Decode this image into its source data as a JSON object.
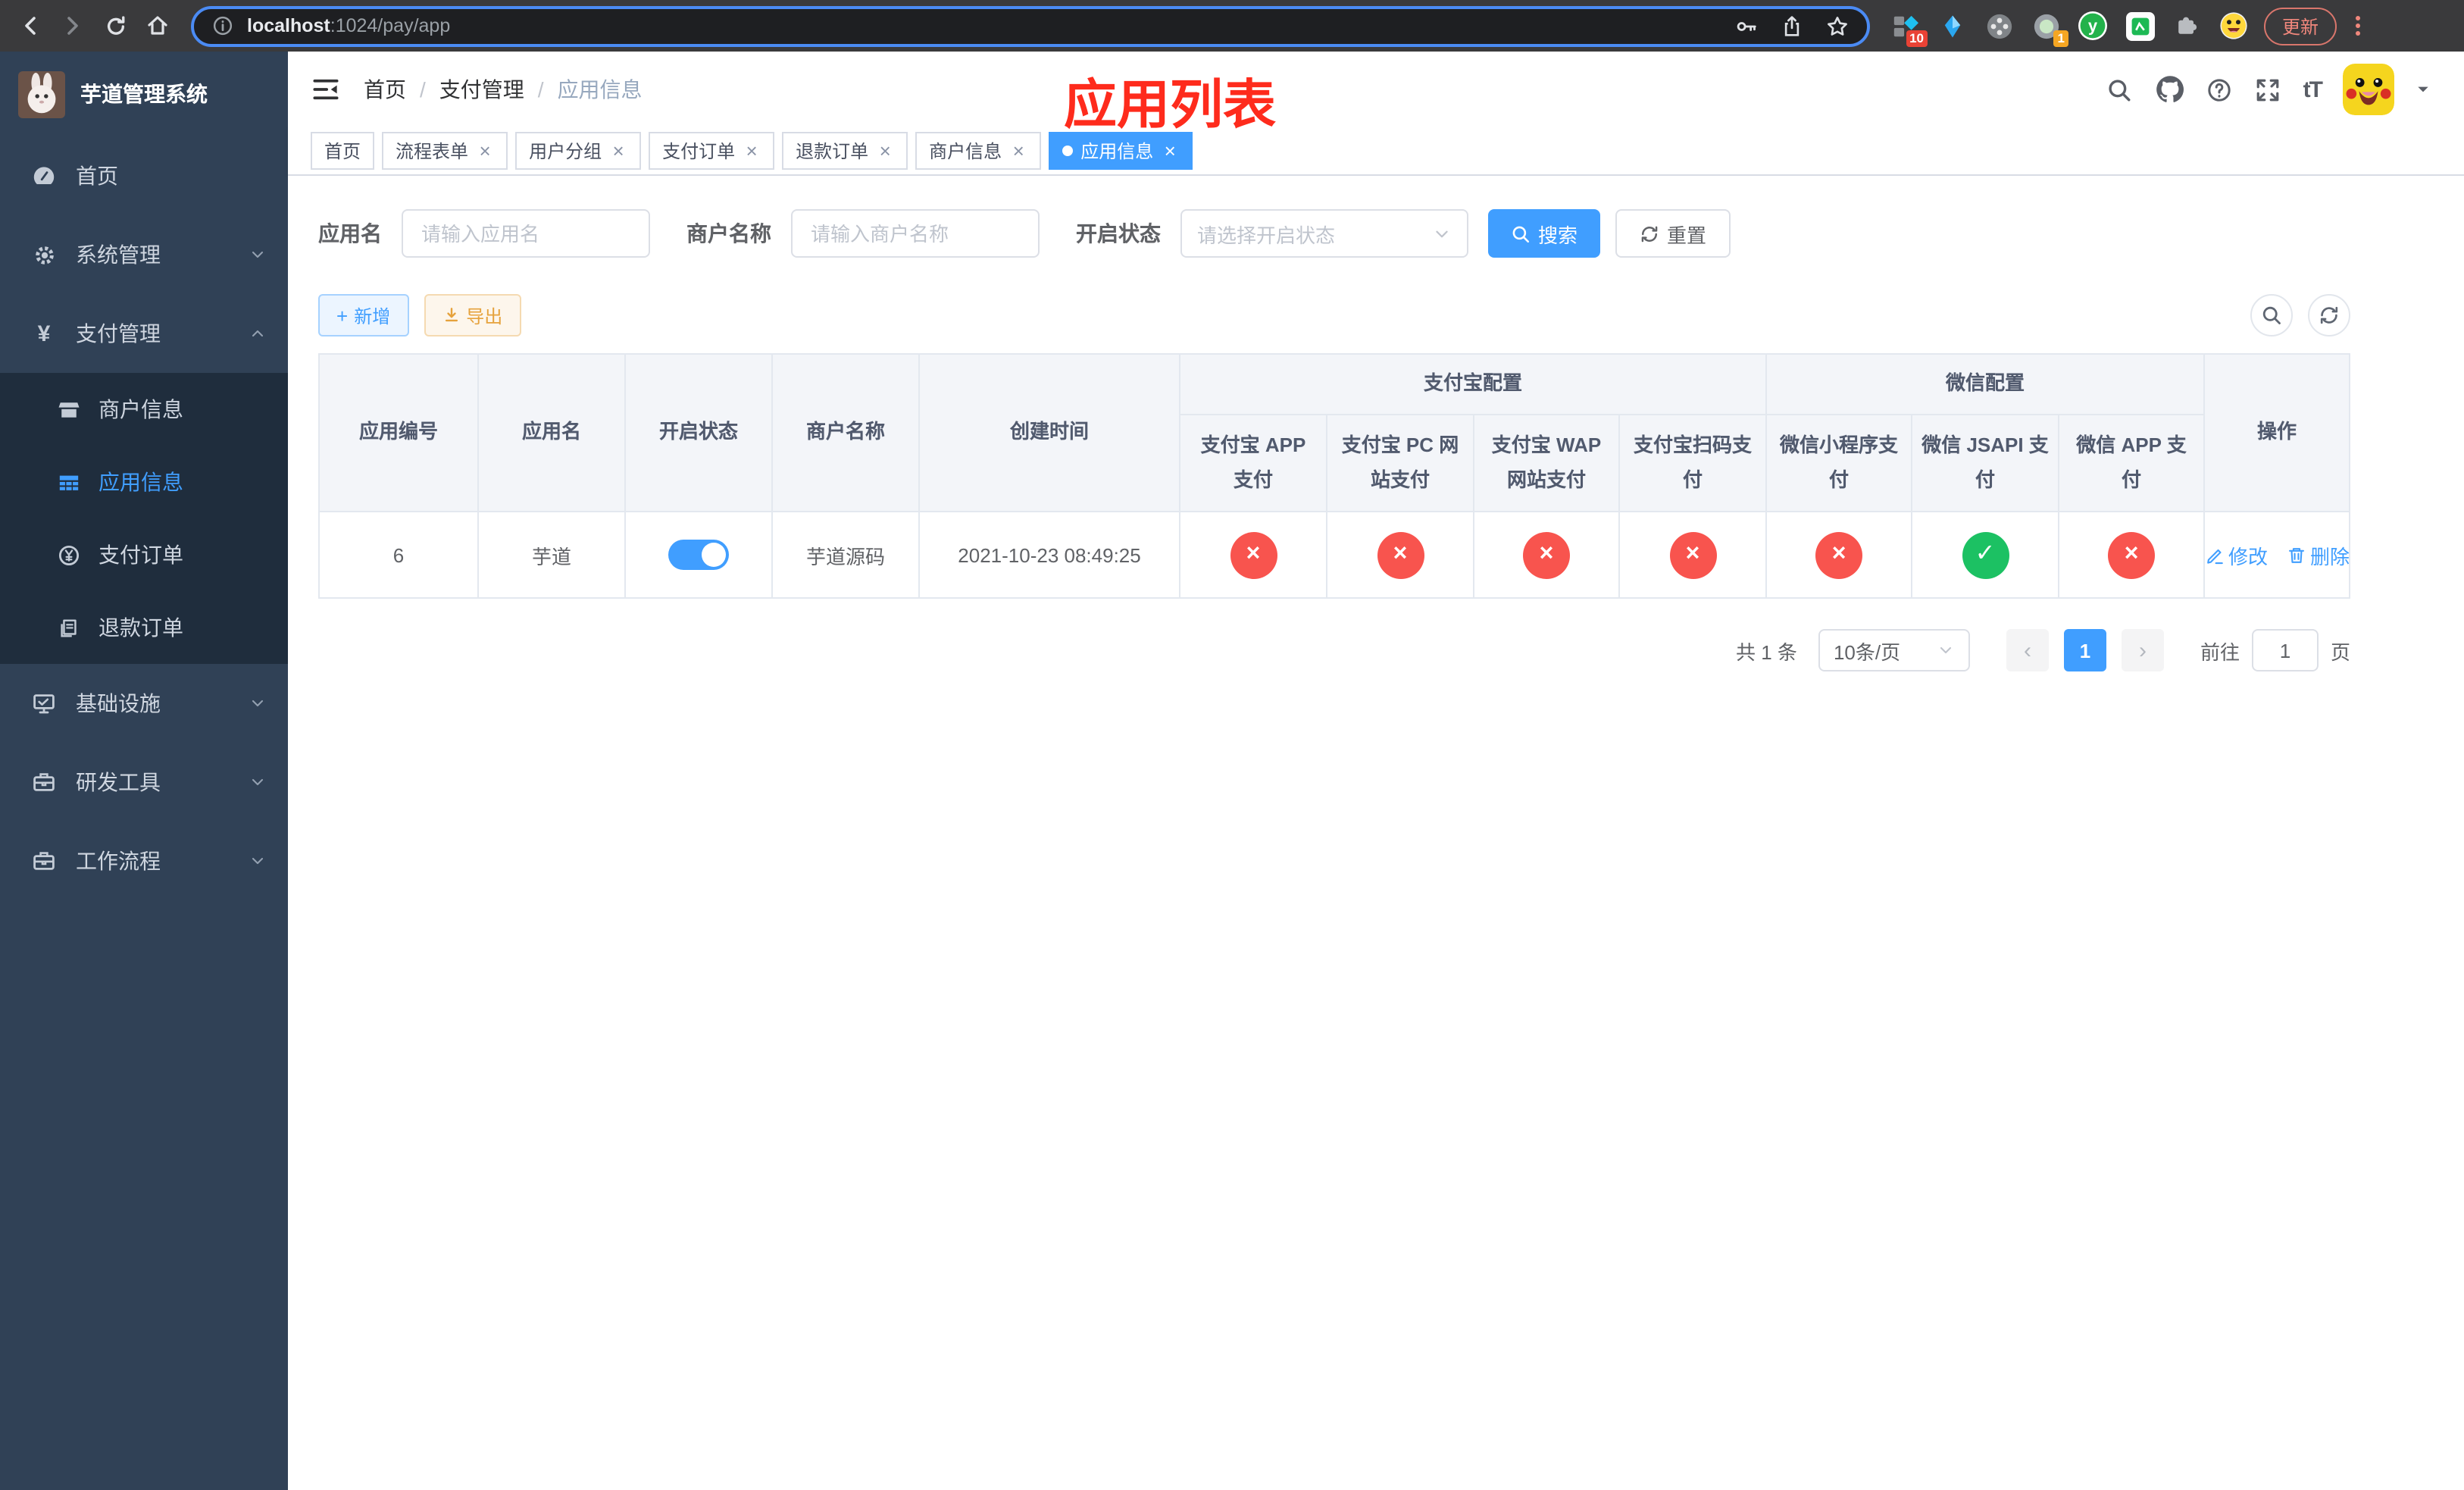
{
  "browser": {
    "url": {
      "host": "localhost",
      "path": ":1024/pay/app"
    },
    "update_label": "更新",
    "extensions": {
      "badge_grid": "10",
      "badge_record": "1",
      "letter_y": "y"
    }
  },
  "sidebar": {
    "title": "芋道管理系统",
    "items": [
      {
        "label": "首页"
      },
      {
        "label": "系统管理"
      },
      {
        "label": "支付管理"
      },
      {
        "label": "基础设施"
      },
      {
        "label": "研发工具"
      },
      {
        "label": "工作流程"
      }
    ],
    "submenu": [
      {
        "label": "商户信息"
      },
      {
        "label": "应用信息"
      },
      {
        "label": "支付订单"
      },
      {
        "label": "退款订单"
      }
    ]
  },
  "header": {
    "breadcrumb": [
      "首页",
      "支付管理",
      "应用信息"
    ],
    "separator": "/",
    "annotation": "应用列表",
    "font_size_icon": "tT"
  },
  "tabs": [
    {
      "label": "首页",
      "closable": false
    },
    {
      "label": "流程表单",
      "closable": true
    },
    {
      "label": "用户分组",
      "closable": true
    },
    {
      "label": "支付订单",
      "closable": true
    },
    {
      "label": "退款订单",
      "closable": true
    },
    {
      "label": "商户信息",
      "closable": true
    },
    {
      "label": "应用信息",
      "closable": true,
      "active": true
    }
  ],
  "filter": {
    "app_name_label": "应用名",
    "app_name_placeholder": "请输入应用名",
    "merchant_label": "商户名称",
    "merchant_placeholder": "请输入商户名称",
    "status_label": "开启状态",
    "status_placeholder": "请选择开启状态",
    "search_label": "搜索",
    "reset_label": "重置"
  },
  "toolbar": {
    "add_label": "新增",
    "export_label": "导出"
  },
  "table": {
    "columns": [
      "应用编号",
      "应用名",
      "开启状态",
      "商户名称",
      "创建时间"
    ],
    "groups": [
      {
        "label": "支付宝配置",
        "columns": [
          "支付宝 APP 支付",
          "支付宝 PC 网站支付",
          "支付宝 WAP 网站支付",
          "支付宝扫码支付"
        ]
      },
      {
        "label": "微信配置",
        "columns": [
          "微信小程序支付",
          "微信 JSAPI 支付",
          "微信 APP 支付"
        ]
      }
    ],
    "action_column": "操作",
    "rows": [
      {
        "app_id": "6",
        "app_name": "芋道",
        "enabled": true,
        "merchant_name": "芋道源码",
        "created_at": "2021-10-23 08:49:25",
        "channels": {
          "alipay_app": false,
          "alipay_pc": false,
          "alipay_wap": false,
          "alipay_qr": false,
          "wx_lite": false,
          "wx_jsapi": true,
          "wx_app": false
        },
        "actions": [
          "修改",
          "删除"
        ]
      }
    ]
  },
  "pagination": {
    "total_text": "共 1 条",
    "page_size": "10条/页",
    "prev": "‹",
    "next": "›",
    "current_page": "1",
    "goto_label": "前往",
    "goto_value": "1",
    "unit_label": "页"
  },
  "icons": {
    "close": "×",
    "check": "✓",
    "cross": "×",
    "yen": "¥"
  },
  "colors": {
    "primary": "#409eff",
    "success": "#1cc163",
    "danger": "#f8544e",
    "warning": "#e6a23c",
    "sidebar_bg": "#304156",
    "submenu_bg": "#1f2d3d",
    "annotation_red": "#fe2b1c"
  }
}
